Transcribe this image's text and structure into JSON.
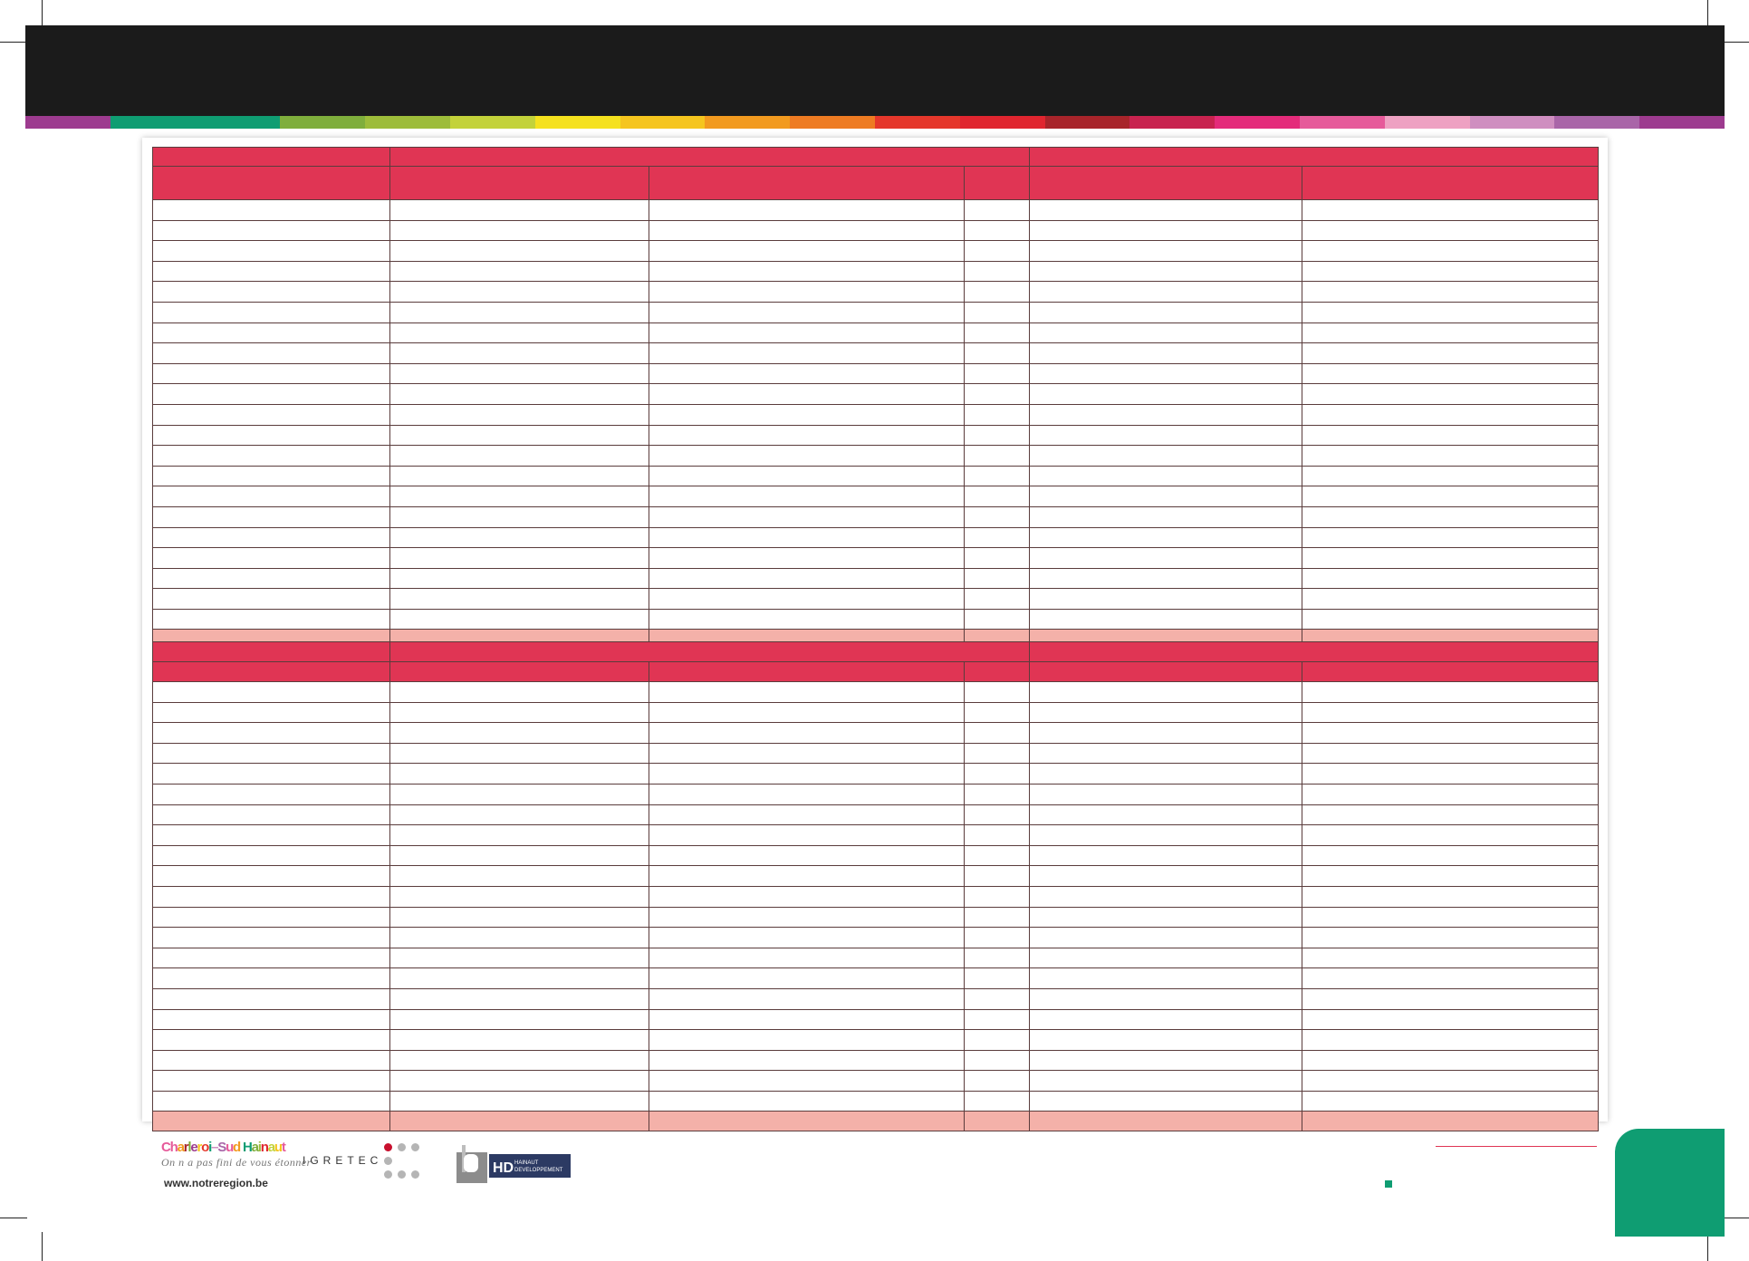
{
  "colors": {
    "header_band": "#1b1b1b",
    "table_header": "#e03554",
    "table_total_row": "#f4b1a9",
    "table_border": "#5a3c3c",
    "accent_green": "#0f9d72",
    "divider": "#e03554"
  },
  "color_strip": [
    "#9d3b8f",
    "#0f9d72",
    "#0f9d72",
    "#7fae3c",
    "#9dbc3a",
    "#c3d23a",
    "#f5e11e",
    "#f5c51e",
    "#f29a1f",
    "#ee7b22",
    "#e5372b",
    "#e0252f",
    "#a8242a",
    "#c8234f",
    "#e42b7a",
    "#e65a9a",
    "#eea1c2",
    "#cf8ec0",
    "#a965a8",
    "#9d3b8f"
  ],
  "tables": [
    {
      "body_row_count": 21
    },
    {
      "body_row_count": 21
    }
  ],
  "footer": {
    "logo_text": "Charleroi–Sud Hainaut",
    "logo_colors": [
      "#e65a9a",
      "#e65a9a",
      "#f29a1f",
      "#a8242a",
      "#7fae3c",
      "#9d3b8f",
      "#f5c51e",
      "#e5372b",
      "#0f9d72",
      "#cf8ec0",
      "#a965a8",
      "#e65a9a",
      "#f29a1f",
      "#e42b7a",
      "#0f9d72",
      "#7fae3c",
      "#9dbc3a",
      "#e0252f",
      "#c3d23a",
      "#f5c51e",
      "#e65a9a"
    ],
    "tagline": "On n a pas fini de vous étonner",
    "url": "www.notreregion.be",
    "igretec": "IGRETEC",
    "hd_line1": "HAINAUT",
    "hd_line2": "DEVELOPPEMENT"
  }
}
